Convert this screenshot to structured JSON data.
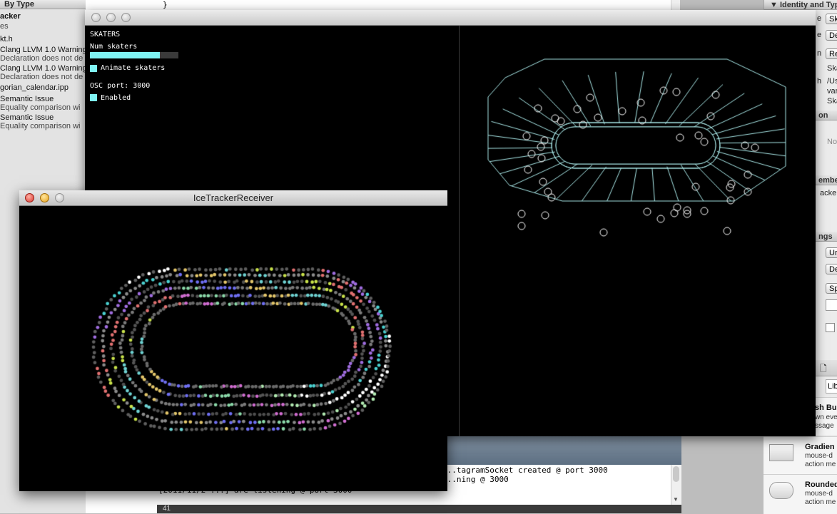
{
  "issue_navigator": {
    "header": "By Type",
    "lines": [
      {
        "text": "acker",
        "style": "bold"
      },
      {
        "text": "es",
        "style": "dim"
      },
      {
        "text": "kt.h",
        "style": "normal"
      },
      {
        "text": "Clang LLVM 1.0 Warning",
        "style": "normal"
      },
      {
        "text": "Declaration does not de",
        "style": "dim"
      },
      {
        "text": "Clang LLVM 1.0 Warning",
        "style": "normal"
      },
      {
        "text": "Declaration does not de",
        "style": "dim"
      },
      {
        "text": "gorian_calendar.ipp",
        "style": "normal"
      },
      {
        "text": "Semantic Issue",
        "style": "normal"
      },
      {
        "text": "Equality comparison wi",
        "style": "dim"
      },
      {
        "text": "Semantic Issue",
        "style": "normal"
      },
      {
        "text": "Equality comparison wi",
        "style": "dim"
      }
    ]
  },
  "editor": {
    "visible_line": "}"
  },
  "console": {
    "lines": [
      "...tagramSocket created @ port 3000",
      "...ning @ 3000",
      "[2011/11/2 ...] are listening @ port 3000"
    ],
    "line_number": "41"
  },
  "utilities": {
    "identity_header": "Identity and Type",
    "field_labels": [
      "e",
      "e",
      "n",
      "h"
    ],
    "field_values": [
      "Sk",
      "De",
      "Re",
      "Ska",
      "/Us",
      "var",
      "Ska"
    ],
    "sections": [
      "on",
      "embers",
      "ngs"
    ],
    "no_text": "No",
    "member_text": "acker",
    "button_values": [
      "Ur",
      "De",
      "Sp"
    ],
    "lib_tab": "Librar",
    "library_items": [
      {
        "title": "sh Bu",
        "desc": [
          "wn eve",
          "ssage"
        ]
      },
      {
        "title": "Gradien",
        "desc": [
          "mouse-d",
          "action me"
        ]
      },
      {
        "title": "Rounded",
        "desc": [
          "mouse-d",
          "action me"
        ]
      }
    ]
  },
  "tracker_window": {
    "panel_title": "SKATERS",
    "num_skaters_label": "Num skaters",
    "num_skaters_fraction": 0.79,
    "animate_label": "Animate skaters",
    "animate_checked": true,
    "osc_port_label": "OSC port: 3000",
    "enabled_label": "Enabled",
    "enabled_checked": true,
    "accent_color": "#7ff3f3",
    "rink_color": "#a9e8e8"
  },
  "receiver_window": {
    "title": "IceTrackerReceiver"
  }
}
